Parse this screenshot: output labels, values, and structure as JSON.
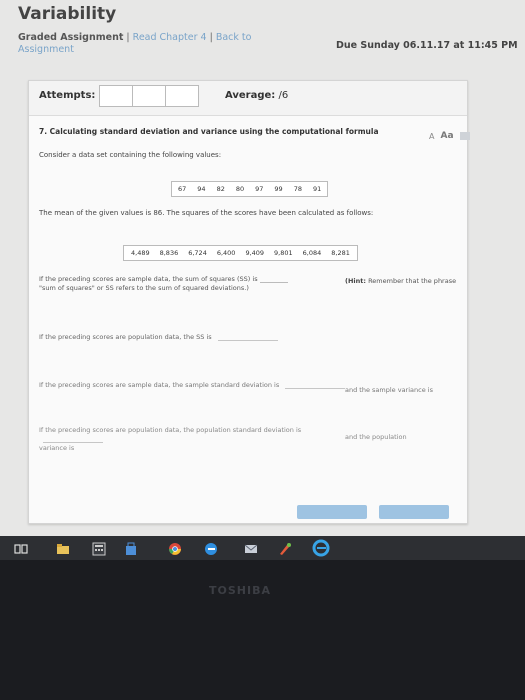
{
  "page": {
    "title": "Variability"
  },
  "header": {
    "lead": "Graded Assignment",
    "link_read": "Read Chapter 4",
    "link_back": "Back to Assignment",
    "due": "Due Sunday 06.11.17 at 11:45 PM"
  },
  "attempts": {
    "label": "Attempts:",
    "average_label": "Average:",
    "average_value": "/6"
  },
  "question": {
    "title": "7. Calculating standard deviation and variance using the computational formula",
    "font_small": "A",
    "font_large": "Aa",
    "prompt": "Consider a data set containing the following values:",
    "values": [
      "67",
      "94",
      "82",
      "80",
      "97",
      "99",
      "78",
      "91"
    ],
    "mean_text": "The mean of the given values is 86. The squares of the scores have been calculated as follows:",
    "squares": [
      "4,489",
      "8,836",
      "6,724",
      "6,400",
      "9,409",
      "9,801",
      "6,084",
      "8,281"
    ],
    "para1a": "If the preceding scores are sample data, the sum of squares (SS) is",
    "para1b": "\"sum of squares\" or SS refers to the sum of squared deviations.)",
    "hint_label": "(Hint:",
    "hint_text": "Remember that the phrase",
    "line2": "If the preceding scores are population data, the SS is",
    "line3": "If the preceding scores are sample data, the sample standard deviation is",
    "line3_right": "and the sample variance is",
    "line4": "If the preceding scores are population data, the population standard deviation is",
    "line4_cont": "variance is",
    "line4_right": "and the population"
  },
  "brand": {
    "text": "TOSHIBA"
  },
  "colors": {
    "link": "#7aa4c9",
    "button": "#9ec3e2",
    "taskbar": "#2d2f33"
  }
}
